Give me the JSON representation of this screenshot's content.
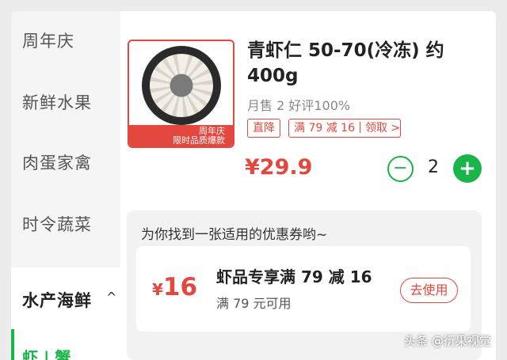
{
  "sidebar": {
    "items": [
      {
        "label": "周年庆"
      },
      {
        "label": "新鲜水果"
      },
      {
        "label": "肉蛋家禽"
      },
      {
        "label": "时令蔬菜"
      }
    ],
    "active_category": "水产海鲜",
    "active_subcategory": "虾 | 蟹"
  },
  "product": {
    "title": "青虾仁 50-70(冷冻) 约400g",
    "sales": "月售 2 好评100%",
    "badge_line1": "周年庆",
    "badge_line2": "限时品质爆款",
    "tags": {
      "direct": "直降",
      "promo": "满 79 减 16",
      "claim": "领取 >"
    },
    "price": "¥29.9",
    "quantity": "2",
    "minus_label": "−",
    "plus_label": "+"
  },
  "coupon": {
    "hint": "为你找到一张适用的优惠券哟~",
    "currency": "¥",
    "amount": "16",
    "name": "虾品专享满 79 减 16",
    "condition": "满 79 元可用",
    "use_label": "去使用"
  },
  "watermark": "头条 @衍果视觉",
  "colors": {
    "accent_green": "#19b44a",
    "accent_red": "#e4473e"
  }
}
